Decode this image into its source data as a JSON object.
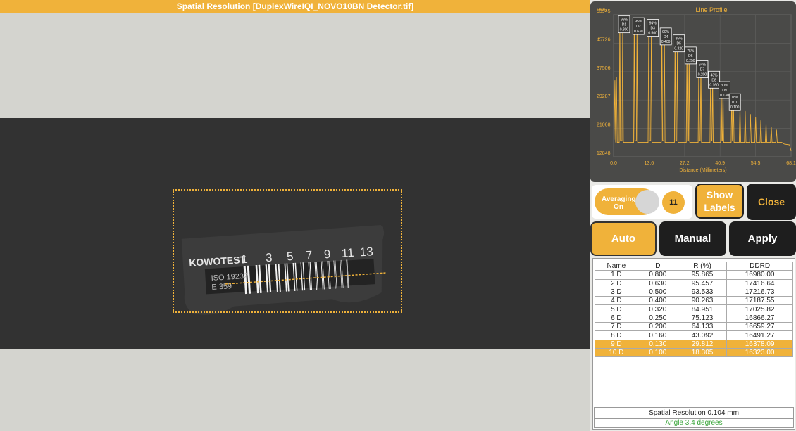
{
  "window": {
    "title": "Spatial Resolution [DuplexWireIQI_NOVO10BN Detector.tif]"
  },
  "image": {
    "iqi_brand": "KOWOTEST",
    "iqi_numbers": [
      "1",
      "3",
      "5",
      "7",
      "9",
      "11",
      "13"
    ],
    "iqi_standard_line1": "ISO 19232",
    "iqi_standard_line2": "E 359"
  },
  "controls": {
    "averaging_label_1": "Averaging",
    "averaging_label_2": "On",
    "averaging_count": "11",
    "show_labels_1": "Show",
    "show_labels_2": "Labels",
    "close": "Close",
    "auto": "Auto",
    "manual": "Manual",
    "apply": "Apply"
  },
  "table": {
    "headers": [
      "Name",
      "D",
      "R (%)",
      "DDRD"
    ],
    "rows": [
      [
        "1 D",
        "0.800",
        "95.865",
        "16980.00"
      ],
      [
        "2 D",
        "0.630",
        "95.457",
        "17416.64"
      ],
      [
        "3 D",
        "0.500",
        "93.533",
        "17216.73"
      ],
      [
        "4 D",
        "0.400",
        "90.263",
        "17187.55"
      ],
      [
        "5 D",
        "0.320",
        "84.951",
        "17025.82"
      ],
      [
        "6 D",
        "0.250",
        "75.123",
        "16866.27"
      ],
      [
        "7 D",
        "0.200",
        "64.133",
        "16659.27"
      ],
      [
        "8 D",
        "0.160",
        "43.092",
        "16491.27"
      ],
      [
        "9 D",
        "0.130",
        "29.812",
        "16378.09"
      ],
      [
        "10 D",
        "0.100",
        "18.305",
        "16323.00"
      ]
    ],
    "highlighted_rows": [
      8,
      9
    ]
  },
  "summary": {
    "spatial_resolution": "Spatial Resolution 0.104 mm",
    "angle": "Angle 3.4 degrees"
  },
  "colors": {
    "accent": "#f0b23a",
    "dark": "#1e1e1e",
    "chart_bg": "#4a4a48",
    "angle_text": "#3aa53a"
  },
  "chart_data": {
    "type": "line",
    "title": "Line Profile",
    "ylabel": "DDR",
    "xlabel": "Distance (Millimeters)",
    "x_ticks": [
      "0.0",
      "13.6",
      "27.2",
      "40.9",
      "54.5",
      "68.1"
    ],
    "y_ticks": [
      "12848",
      "21068",
      "29287",
      "37506",
      "45726",
      "53945"
    ],
    "xlim": [
      0,
      68.1
    ],
    "ylim": [
      12848,
      53945
    ],
    "grid": true,
    "wire_pairs": [
      {
        "label_r": "96%",
        "label_name": "D1",
        "label_d": "0.800",
        "x": 3.5,
        "peak": 53000
      },
      {
        "label_r": "95%",
        "label_name": "D2",
        "label_d": "0.630",
        "x": 9.0,
        "peak": 52500
      },
      {
        "label_r": "94%",
        "label_name": "D3",
        "label_d": "0.500",
        "x": 14.5,
        "peak": 52000
      },
      {
        "label_r": "90%",
        "label_name": "D4",
        "label_d": "0.400",
        "x": 19.5,
        "peak": 49500
      },
      {
        "label_r": "85%",
        "label_name": "D5",
        "label_d": "0.320",
        "x": 24.5,
        "peak": 47500
      },
      {
        "label_r": "75%",
        "label_name": "D6",
        "label_d": "0.250",
        "x": 29.0,
        "peak": 44000
      },
      {
        "label_r": "64%",
        "label_name": "D7",
        "label_d": "0.200",
        "x": 33.5,
        "peak": 40000
      },
      {
        "label_r": "43%",
        "label_name": "D8",
        "label_d": "0.160",
        "x": 38.0,
        "peak": 37000
      },
      {
        "label_r": "30%",
        "label_name": "D9",
        "label_d": "0.130",
        "x": 42.0,
        "peak": 34000
      },
      {
        "label_r": "18%",
        "label_name": "D10",
        "label_d": "0.100",
        "x": 46.0,
        "peak": 30500
      }
    ],
    "baseline": 17000
  }
}
